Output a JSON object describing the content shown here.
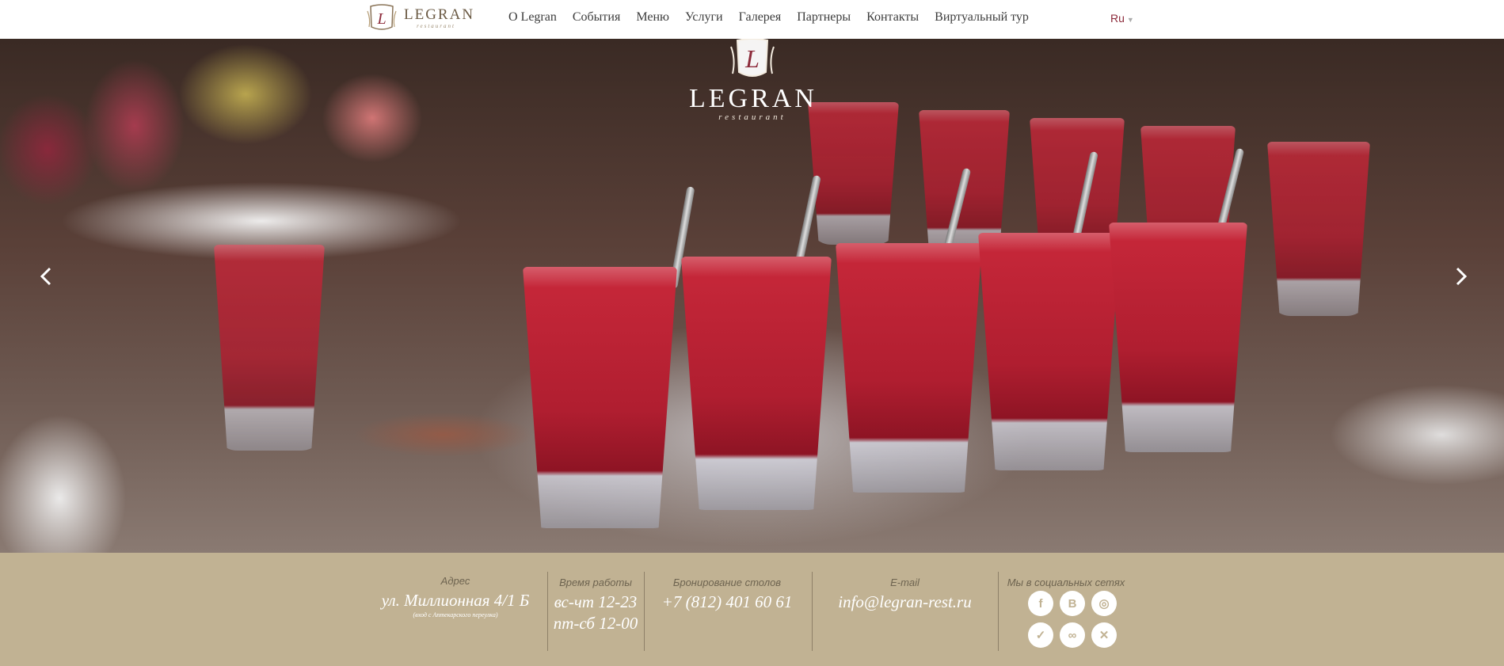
{
  "header": {
    "logo_text": "LEGRAN",
    "logo_sub": "restaurant",
    "logo_initial": "L",
    "nav": [
      "О Legran",
      "События",
      "Меню",
      "Услуги",
      "Галерея",
      "Партнеры",
      "Контакты",
      "Виртуальный тур"
    ],
    "language": "Ru"
  },
  "hero": {
    "logo_initial": "L",
    "logo_text": "LEGRAN",
    "logo_sub": "restaurant",
    "prev_icon": "chevron-left-icon",
    "next_icon": "chevron-right-icon"
  },
  "footer": {
    "address": {
      "label": "Адрес",
      "value": "ул. Миллионная 4/1 Б",
      "note": "(вход с Аптекарского переулка)"
    },
    "hours": {
      "label": "Время работы",
      "line1": "вс-чт 12-23",
      "line2": "пт-сб 12-00"
    },
    "booking": {
      "label": "Бронирование столов",
      "phone": "+7 (812) 401 60 61"
    },
    "email": {
      "label": "E-mail",
      "value": "info@legran-rest.ru"
    },
    "social": {
      "label": "Мы в социальных сетях",
      "icons": [
        "facebook-icon",
        "vk-icon",
        "instagram-icon",
        "foursquare-icon",
        "tripadvisor-icon",
        "restaurant-guide-icon"
      ],
      "glyphs": [
        "f",
        "B",
        "◎",
        "✓",
        "∞",
        "✕"
      ]
    }
  },
  "colors": {
    "footer_bg": "#c1b293",
    "brand": "#6b5a44",
    "lang_accent": "#8c2a3a"
  }
}
